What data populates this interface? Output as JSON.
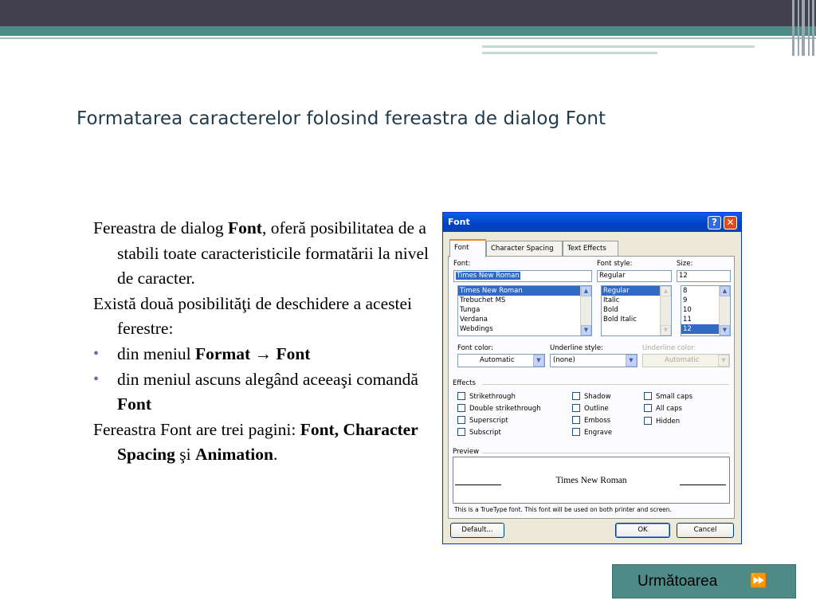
{
  "slide": {
    "title": "Formatarea caracterelor folosind fereastra de dialog Font",
    "body": {
      "p1_pre": "Fereastra de dialog ",
      "p1_bold": "Font",
      "p1_post": ", oferă posibilitatea de a stabili toate caracteristicile formatării la nivel de caracter.",
      "p2": "Există două posibilităţi de deschidere a acestei ferestre:",
      "b1_pre": "din meniul ",
      "b1_bold1": "Format",
      "b1_arrow": " → ",
      "b1_bold2": "Font",
      "b2_pre": "din meniul ascuns alegând aceeaşi comandă ",
      "b2_bold": "Font",
      "p3_pre": "Fereastra Font are trei pagini: ",
      "p3_bold1": "Font,",
      "p3_space": " ",
      "p3_bold2": "Character Spacing",
      "p3_and": " şi ",
      "p3_bold3": "Animation",
      "p3_end": "."
    },
    "next_button": {
      "label": "Următoarea",
      "icon": "fast-forward-icon"
    },
    "colors": {
      "title": "#1f3b4d",
      "teal": "#4e8b87",
      "dark_bar": "#43414f",
      "bullet": "#8c5fa5"
    }
  },
  "dialog": {
    "title": "Font",
    "help_glyph": "?",
    "close_glyph": "✕",
    "tabs": [
      "Font",
      "Character Spacing",
      "Text Effects"
    ],
    "font": {
      "label": "Font:",
      "value": "Times New Roman",
      "items": [
        "Times New Roman",
        "Trebuchet MS",
        "Tunga",
        "Verdana",
        "Webdings"
      ],
      "selected": "Times New Roman"
    },
    "style": {
      "label": "Font style:",
      "value": "Regular",
      "items": [
        "Regular",
        "Italic",
        "Bold",
        "Bold Italic"
      ],
      "selected": "Regular"
    },
    "size": {
      "label": "Size:",
      "value": "12",
      "items": [
        "8",
        "9",
        "10",
        "11",
        "12"
      ],
      "selected": "12"
    },
    "font_color": {
      "label": "Font color:",
      "value": "Automatic"
    },
    "underline_style": {
      "label": "Underline style:",
      "value": "(none)"
    },
    "underline_color": {
      "label": "Underline color:",
      "value": "Automatic"
    },
    "effects": {
      "label": "Effects",
      "col1": [
        "Strikethrough",
        "Double strikethrough",
        "Superscript",
        "Subscript"
      ],
      "col2": [
        "Shadow",
        "Outline",
        "Emboss",
        "Engrave"
      ],
      "col3": [
        "Small caps",
        "All caps",
        "Hidden"
      ]
    },
    "preview": {
      "label": "Preview",
      "sample": "Times New Roman",
      "note": "This is a TrueType font. This font will be used on both printer and screen."
    },
    "buttons": {
      "default": "Default...",
      "ok": "OK",
      "cancel": "Cancel"
    }
  }
}
